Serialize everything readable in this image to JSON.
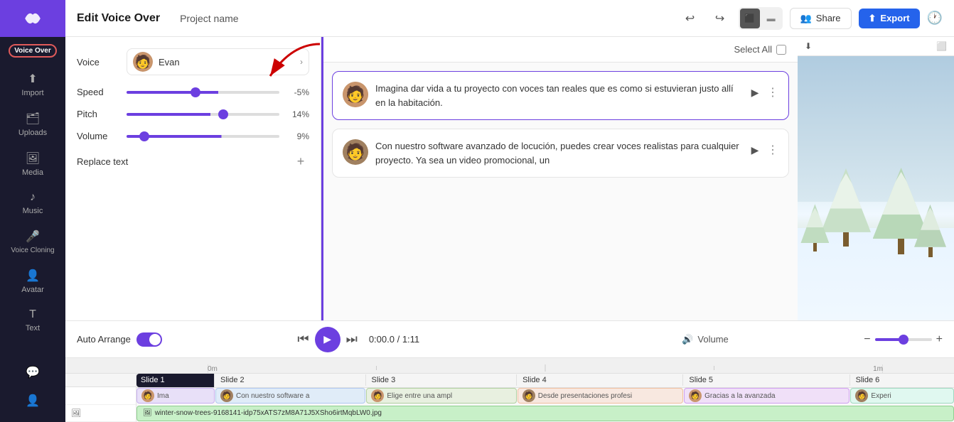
{
  "app": {
    "title": "Edit Voice Over",
    "project_name": "Project name",
    "logo": "♪"
  },
  "header": {
    "title": "Edit Voice Over",
    "project": "Project name",
    "share_label": "Share",
    "export_label": "Export",
    "undo_icon": "↩",
    "redo_icon": "↪"
  },
  "sidebar": {
    "items": [
      {
        "label": "Voice Over",
        "active": true
      },
      {
        "label": "Import",
        "active": false
      },
      {
        "label": "Uploads",
        "active": false
      },
      {
        "label": "Media",
        "active": false
      },
      {
        "label": "Music",
        "active": false
      },
      {
        "label": "Voice Cloning",
        "active": false
      },
      {
        "label": "Avatar",
        "active": false
      },
      {
        "label": "Text",
        "active": false
      }
    ]
  },
  "controls": {
    "voice_label": "Voice",
    "voice_name": "Evan",
    "speed_label": "Speed",
    "speed_value": "-5%",
    "pitch_label": "Pitch",
    "pitch_value": "14%",
    "volume_label": "Volume",
    "volume_value": "9%",
    "replace_text_label": "Replace text"
  },
  "voiceover_list": {
    "select_all_label": "Select All",
    "items": [
      {
        "id": 1,
        "text": "Imagina dar vida a tu proyecto con voces tan reales que es como si estuvieran justo allí en la habitación.",
        "active": true
      },
      {
        "id": 2,
        "text": "Con nuestro software avanzado de locución, puedes crear voces realistas para cualquier proyecto. Ya sea un video promocional, un",
        "active": false
      }
    ]
  },
  "playback": {
    "auto_arrange_label": "Auto Arrange",
    "current_time": "0:00.0",
    "total_time": "1:11",
    "volume_label": "Volume"
  },
  "timeline": {
    "ruler_labels": [
      "0m",
      "1m"
    ],
    "slides": [
      {
        "label": "Slide 1",
        "clip_text": "Ima",
        "clip_color": "clip-1"
      },
      {
        "label": "Slide 2",
        "clip_text": "Con nuestro software a",
        "clip_color": "clip-2"
      },
      {
        "label": "Slide 3",
        "clip_text": "Elige entre una ampl",
        "clip_color": "clip-3"
      },
      {
        "label": "Slide 4",
        "clip_text": "Desde presentaciones profesi",
        "clip_color": "clip-4"
      },
      {
        "label": "Slide 5",
        "clip_text": "Gracias a la avanzada",
        "clip_color": "clip-5"
      },
      {
        "label": "Slide 6",
        "clip_text": "Experi",
        "clip_color": "clip-6"
      }
    ],
    "media_label": "winter-snow-trees-9168141-idp75xATS7zM8A71J5XSho6irtMqbLW0.jpg"
  }
}
